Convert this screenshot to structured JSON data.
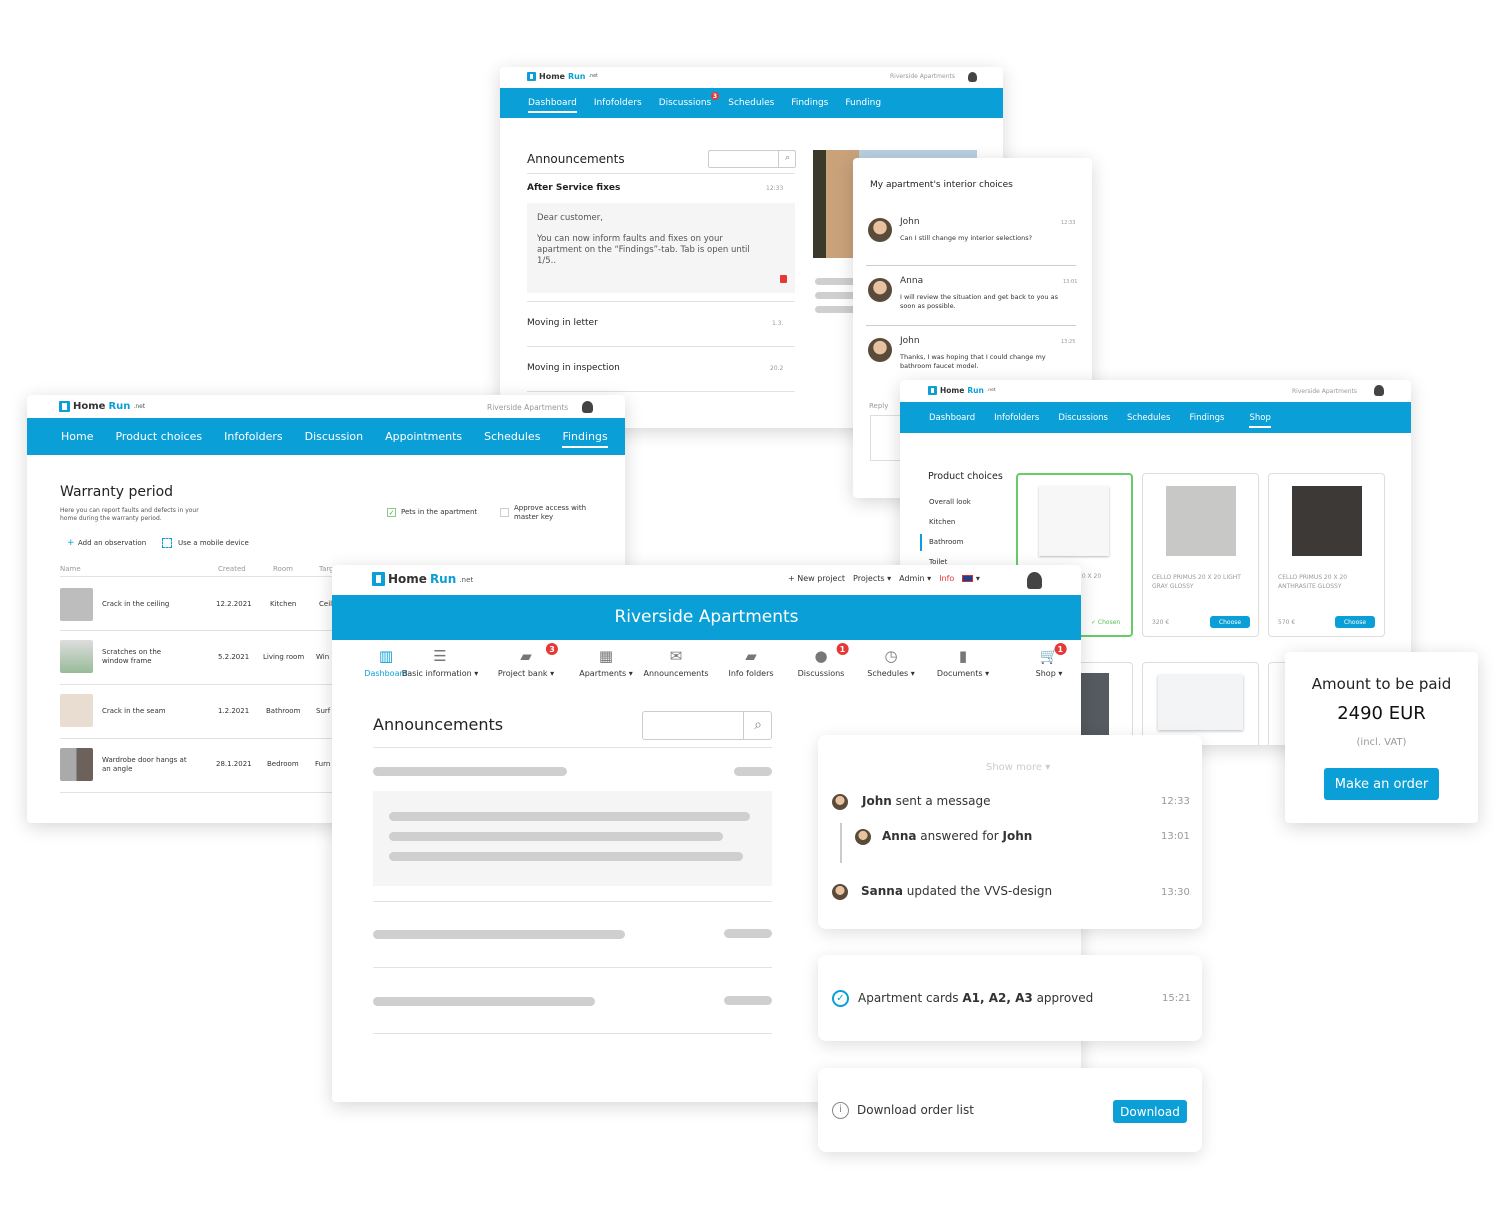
{
  "brand": {
    "name_a": "Home",
    "name_b": "Run",
    "suffix": ".net",
    "accent": "#0a9fd6"
  },
  "project": "Riverside Apartments",
  "panel_dashboard": {
    "nav": [
      "Dashboard",
      "Infofolders",
      "Discussions",
      "Schedules",
      "Findings",
      "Funding"
    ],
    "discussions_badge": "3",
    "title": "Announcements",
    "items": [
      {
        "title": "After Service fixes",
        "time": "12:33",
        "body_greeting": "Dear customer,",
        "body": "You can now inform faults and fixes on your apartment on the “Findings”-tab. Tab is open until 1/5.."
      },
      {
        "title": "Moving in letter",
        "time": "1.3."
      },
      {
        "title": "Moving in inspection",
        "time": "20.2"
      }
    ]
  },
  "panel_chat": {
    "title": "My apartment's interior choices",
    "messages": [
      {
        "name": "John",
        "time": "12:33",
        "text": "Can I still change my interior selections?"
      },
      {
        "name": "Anna",
        "time": "13:01",
        "text": "I will review the situation and get back to you as soon as possible."
      },
      {
        "name": "John",
        "time": "13:25",
        "text": "Thanks, I was hoping that I could change my bathroom faucet model."
      }
    ],
    "reply_label": "Reply"
  },
  "panel_warranty": {
    "nav": [
      "Home",
      "Product choices",
      "Infofolders",
      "Discussion",
      "Appointments",
      "Schedules",
      "Findings"
    ],
    "title": "Warranty period",
    "subtitle": "Here you can report faults and defects in your home during the warranty period.",
    "pets_label": "Pets in the apartment",
    "pets_checked": true,
    "access_label": "Approve access with master key",
    "access_checked": false,
    "add_label": "Add an observation",
    "mobile_label": "Use a mobile device",
    "columns": [
      "Name",
      "Created",
      "Room",
      "Targ"
    ],
    "rows": [
      {
        "name": "Crack in the ceiling",
        "created": "12.2.2021",
        "room": "Kitchen",
        "target": "Ceil"
      },
      {
        "name": "Scratches on the window frame",
        "created": "5.2.2021",
        "room": "Living room",
        "target": "Win"
      },
      {
        "name": "Crack in the seam",
        "created": "1.2.2021",
        "room": "Bathroom",
        "target": "Surf"
      },
      {
        "name": "Wardrobe door hangs at an angle",
        "created": "28.1.2021",
        "room": "Bedroom",
        "target": "Furn"
      }
    ]
  },
  "panel_shop": {
    "nav": [
      "Dashboard",
      "Infofolders",
      "Discussions",
      "Schedules",
      "Findings",
      "Shop"
    ],
    "title": "Product choices",
    "categories": [
      "Overall look",
      "Kitchen",
      "Bathroom",
      "Toilet"
    ],
    "products": [
      {
        "name": "20 X 20",
        "price": "",
        "status": "✓ Chosen",
        "color": "#f7f7f7"
      },
      {
        "name": "CELLO PRIMUS 20 X 20 LIGHT GRAY GLOSSY",
        "price": "320 €",
        "button": "Choose",
        "color": "#c8c8c6"
      },
      {
        "name": "CELLO PRIMUS 20 X 20 ANTHRASITE GLOSSY",
        "price": "570 €",
        "button": "Choose",
        "color": "#3d3937"
      }
    ]
  },
  "panel_main": {
    "top_links": [
      "+ New project",
      "Projects ▾",
      "Admin ▾",
      "Info",
      "▾"
    ],
    "banner": "Riverside Apartments",
    "menu": [
      {
        "label": "Dashboard",
        "icon": "dashboard-icon",
        "badge": ""
      },
      {
        "label": "Basic information ▾",
        "icon": "list-icon",
        "badge": ""
      },
      {
        "label": "Project bank ▾",
        "icon": "folder-open-icon",
        "badge": "3"
      },
      {
        "label": "Apartments ▾",
        "icon": "building-icon",
        "badge": ""
      },
      {
        "label": "Announcements",
        "icon": "envelope-icon",
        "badge": ""
      },
      {
        "label": "Info folders",
        "icon": "folder-icon",
        "badge": ""
      },
      {
        "label": "Discussions",
        "icon": "chat-bubble-icon",
        "badge": "1"
      },
      {
        "label": "Schedules ▾",
        "icon": "clock-icon",
        "badge": ""
      },
      {
        "label": "Documents ▾",
        "icon": "document-icon",
        "badge": ""
      },
      {
        "label": "Shop ▾",
        "icon": "cart-icon",
        "badge": "1"
      }
    ],
    "title": "Announcements"
  },
  "activity": {
    "show_more": "Show more ▾",
    "items": [
      {
        "who": "John",
        "text": " sent a message",
        "time": "12:33"
      },
      {
        "who": "Anna",
        "text": " answered for ",
        "who2": "John",
        "time": "13:01"
      },
      {
        "who": "Sanna",
        "text": " updated the VVS-design",
        "time": "13:30"
      }
    ],
    "approved_pre": "Apartment cards ",
    "approved_bold": "A1, A2, A3",
    "approved_post": " approved",
    "approved_time": "15:21",
    "download_text": "Download order list",
    "download_button": "Download"
  },
  "order": {
    "title": "Amount to be paid",
    "amount": "2490 EUR",
    "vat": "(incl. VAT)",
    "button": "Make an order"
  }
}
